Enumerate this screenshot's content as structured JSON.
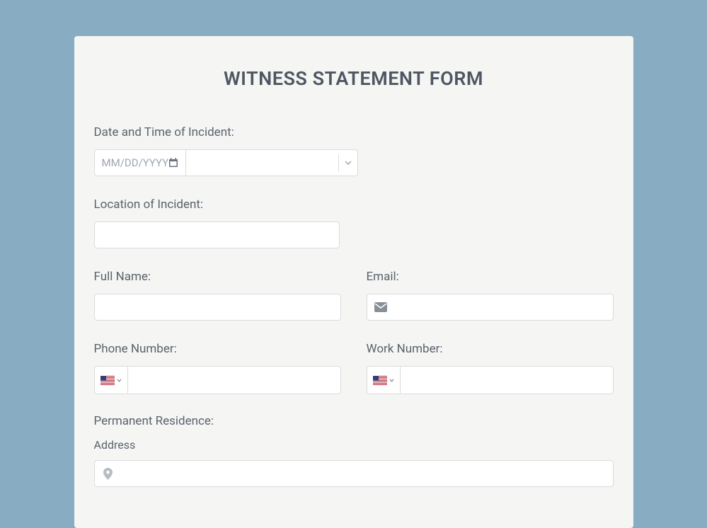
{
  "form": {
    "title": "WITNESS STATEMENT FORM",
    "date_time_label": "Date and Time of Incident:",
    "date_placeholder": "MM/DD/YYYY",
    "location_label": "Location of Incident:",
    "full_name_label": "Full Name:",
    "email_label": "Email:",
    "phone_label": "Phone Number:",
    "work_phone_label": "Work Number:",
    "residence_label": "Permanent Residence:",
    "address_sublabel": "Address",
    "country_code": "US"
  }
}
